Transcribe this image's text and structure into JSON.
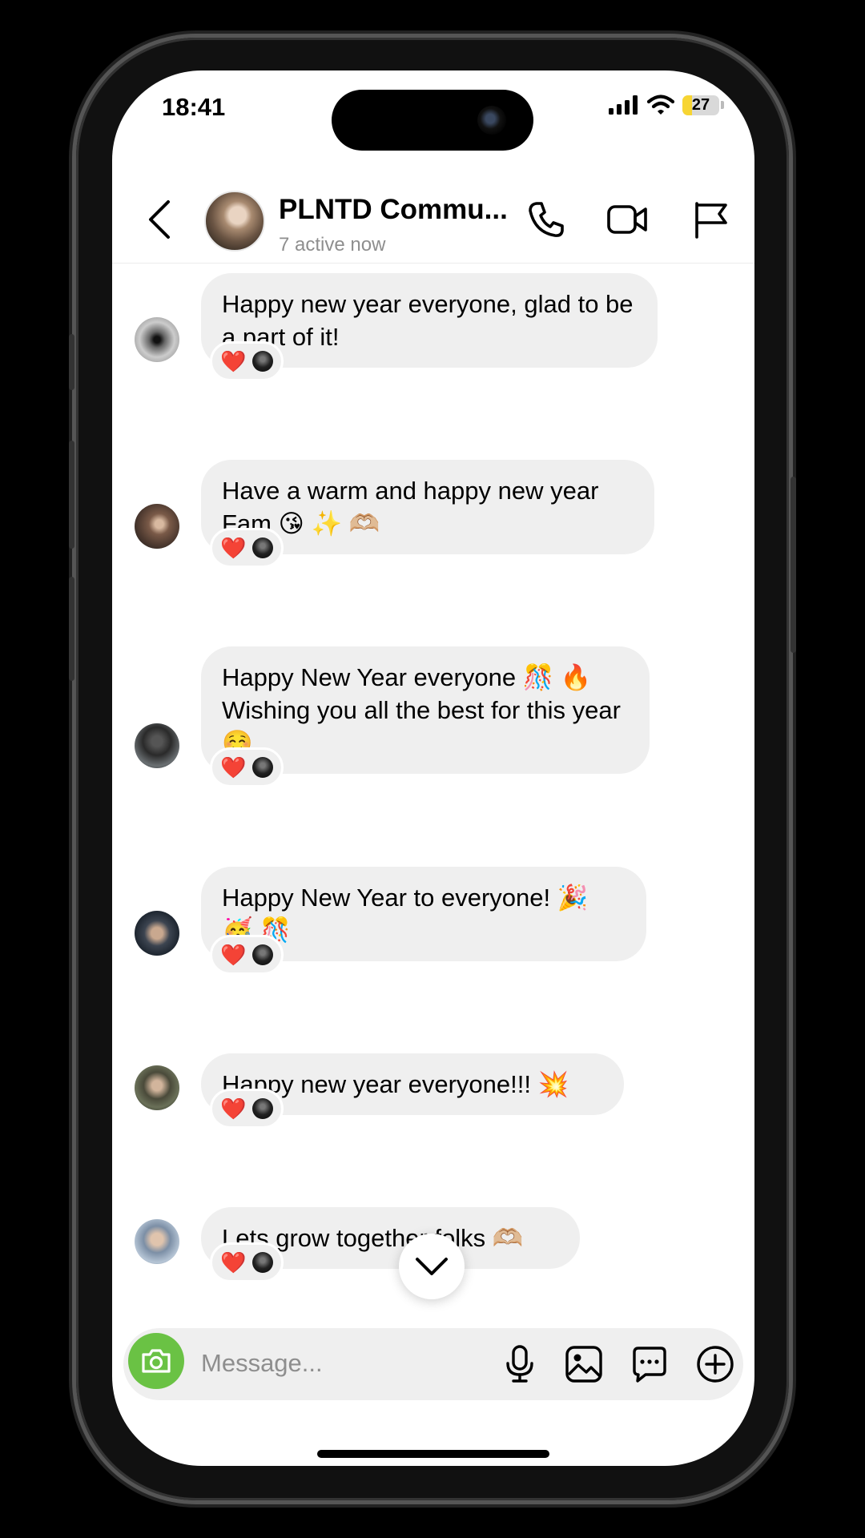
{
  "status_bar": {
    "time": "18:41",
    "battery": "27",
    "battery_level": 0.27
  },
  "header": {
    "group_name": "PLNTD Commu...",
    "subtitle": "7 active now",
    "icons": [
      "back-icon",
      "phone-icon",
      "video-icon",
      "flag-icon"
    ]
  },
  "messages": [
    {
      "text": "Happy new year everyone, glad to be a part of it!",
      "reactions": [
        "❤️"
      ]
    },
    {
      "text": "Have a warm and happy new year Fam 😘 ✨ 🫶🏼",
      "reactions": [
        "❤️"
      ]
    },
    {
      "text": "Happy New Year everyone 🎊 🔥 Wishing you all the best for this year ☺️",
      "reactions": [
        "❤️"
      ]
    },
    {
      "text": "Happy New Year to everyone! 🎉 🥳 🎊",
      "reactions": [
        "❤️"
      ]
    },
    {
      "text": "Happy new year everyone!!! 💥",
      "reactions": [
        "❤️"
      ]
    },
    {
      "text": "Lets grow together folks 🫶🏼",
      "reactions": [
        "❤️"
      ]
    }
  ],
  "composer": {
    "placeholder": "Message...",
    "icons": [
      "camera-icon",
      "microphone-icon",
      "image-icon",
      "sticker-icon",
      "plus-icon"
    ]
  },
  "colors": {
    "bubble": "#efefef",
    "camera_button": "#6ac244",
    "heart": "#e0163a",
    "battery": "#f7d533",
    "secondary_text": "#8e8e8e"
  }
}
